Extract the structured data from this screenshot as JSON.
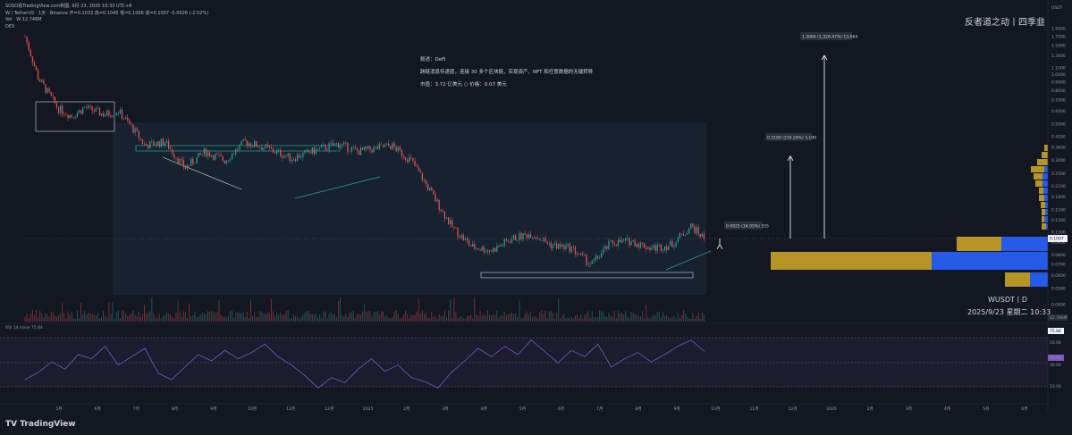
{
  "header": {
    "site": "SOSO看TradingView.com制图, 9月 23, 2025 10:33 UTC+8",
    "symbol_line": "W / TetherUS · 1天 · Binance  开=0.1033  高=0.1045  低=0.1006  收=0.1007  -0.0026 (-2.52%)",
    "vol_line": "Vol · W  12.746M",
    "small_line": "DEX"
  },
  "brand_text": "反者道之动丨四季韭",
  "description": {
    "l1": "叙述：DeFi",
    "l2": "跨链消息传递层，连接 30 多个区块链，实现资产、NFT 和任意数据的无缝转移",
    "l3": "市值：3.72 亿美元 ○ 价格：0.07 美元"
  },
  "watermark": {
    "symbol": "WUSDT丨D",
    "datetime": "2025/9/23 星期二  10:33"
  },
  "targets": [
    {
      "label": "0.0925 (34.05%) 335",
      "value": 0.0925
    },
    {
      "label": "0.3190 (230.24%) 3,190",
      "value": 0.319
    },
    {
      "label": "1.3064 (1,326.47%) 13,064",
      "value": 1.3064
    }
  ],
  "price_axis": {
    "currency": "USDT",
    "ticks": [
      "1.9000",
      "1.7000",
      "1.5000",
      "1.3000",
      "1.1000",
      "1.0000",
      "0.9000",
      "0.8000",
      "0.7000",
      "0.6000",
      "0.5000",
      "0.4200",
      "0.3600",
      "0.3000",
      "0.2500",
      "0.2100",
      "0.1800",
      "0.1500",
      "0.1300",
      "0.1100",
      "0.0950",
      "0.0800",
      "0.0700",
      "0.0600",
      "0.0500",
      "0.0400"
    ],
    "current_price": "0.1007",
    "vol_label": "12.746M"
  },
  "time_axis": {
    "ticks": [
      "5月",
      "6月",
      "7月",
      "8月",
      "9月",
      "10月",
      "11月",
      "12月",
      "2025",
      "2月",
      "3月",
      "4月",
      "5月",
      "6月",
      "7月",
      "8月",
      "9月",
      "10月",
      "11月",
      "12月",
      "2026",
      "2月",
      "3月",
      "4月",
      "5月",
      "6月"
    ]
  },
  "rsi": {
    "label": "RSI 14 close",
    "value": "75.84",
    "ticks": [
      "75.84",
      "50.00",
      "53.52",
      "30.00",
      "23.00"
    ],
    "level_labels": [
      "70.00",
      "50.00",
      "30.00"
    ]
  },
  "logo_text": "TradingView",
  "colors": {
    "bg": "#131722",
    "up": "#26a69a",
    "down": "#ef5350",
    "rsi": "#7e57c2",
    "vp_gold": "#c9a227",
    "vp_blue": "#2962ff",
    "zone": "#1c2a3a"
  },
  "chart_data": {
    "type": "candlestick",
    "symbol": "W/USDT",
    "interval": "1D",
    "y_scale": "log",
    "current_price": 0.1007,
    "targets": [
      0.0925,
      0.319,
      1.3064
    ],
    "price_path": [
      {
        "t": 0,
        "p": 1.7
      },
      {
        "t": 2,
        "p": 0.95
      },
      {
        "t": 5,
        "p": 0.62
      },
      {
        "t": 7,
        "p": 0.56
      },
      {
        "t": 9,
        "p": 0.63
      },
      {
        "t": 12,
        "p": 0.57
      },
      {
        "t": 14,
        "p": 0.6
      },
      {
        "t": 16,
        "p": 0.48
      },
      {
        "t": 18,
        "p": 0.37
      },
      {
        "t": 21,
        "p": 0.39
      },
      {
        "t": 24,
        "p": 0.27
      },
      {
        "t": 27,
        "p": 0.34
      },
      {
        "t": 30,
        "p": 0.3
      },
      {
        "t": 33,
        "p": 0.39
      },
      {
        "t": 36,
        "p": 0.36
      },
      {
        "t": 40,
        "p": 0.31
      },
      {
        "t": 44,
        "p": 0.35
      },
      {
        "t": 47,
        "p": 0.38
      },
      {
        "t": 50,
        "p": 0.34
      },
      {
        "t": 55,
        "p": 0.37
      },
      {
        "t": 58,
        "p": 0.3
      },
      {
        "t": 61,
        "p": 0.19
      },
      {
        "t": 64,
        "p": 0.12
      },
      {
        "t": 67,
        "p": 0.09
      },
      {
        "t": 70,
        "p": 0.085
      },
      {
        "t": 73,
        "p": 0.1
      },
      {
        "t": 76,
        "p": 0.108
      },
      {
        "t": 79,
        "p": 0.092
      },
      {
        "t": 82,
        "p": 0.088
      },
      {
        "t": 85,
        "p": 0.07
      },
      {
        "t": 88,
        "p": 0.095
      },
      {
        "t": 91,
        "p": 0.097
      },
      {
        "t": 94,
        "p": 0.088
      },
      {
        "t": 97,
        "p": 0.092
      },
      {
        "t": 100,
        "p": 0.12
      },
      {
        "t": 102,
        "p": 0.1007
      }
    ],
    "rsi_path": [
      38,
      45,
      55,
      48,
      62,
      58,
      70,
      52,
      60,
      68,
      44,
      38,
      50,
      62,
      56,
      66,
      58,
      64,
      72,
      60,
      52,
      42,
      30,
      40,
      35,
      48,
      58,
      46,
      52,
      40,
      36,
      30,
      45,
      56,
      68,
      60,
      70,
      62,
      76,
      65,
      54,
      66,
      60,
      72,
      50,
      58,
      64,
      55,
      62,
      70,
      76,
      65
    ]
  }
}
